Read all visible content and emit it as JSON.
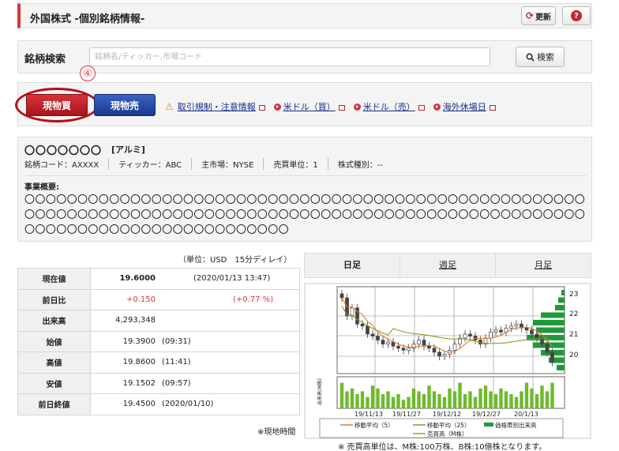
{
  "header": {
    "title": "外国株式 -個別銘柄情報-",
    "refresh_label": "更新",
    "help_label": "?"
  },
  "search": {
    "label": "銘柄検索",
    "placeholder": "銘柄名/ティッカー,市場コード",
    "button_label": "検索"
  },
  "annotation_marker": "④",
  "trade": {
    "buy_label": "現物買",
    "sell_label": "現物売",
    "links": [
      "取引規制・注意情報",
      "米ドル（買）",
      "米ドル（売）",
      "海外休場日"
    ]
  },
  "stock": {
    "name": "〇〇〇〇〇〇〇",
    "tag": "[アルミ]",
    "code": "銘柄コード：AXXXX",
    "ticker": "ティッカー：ABC",
    "market": "主市場：NYSE",
    "unit": "売買単位：1",
    "type": "株式種別：--",
    "business_label": "事業概要:",
    "business_text": "〇〇〇〇〇〇〇〇〇〇〇〇〇〇〇〇〇〇〇〇〇〇〇〇〇〇〇〇〇〇〇〇〇〇〇〇〇〇〇〇〇〇〇〇〇〇〇〇〇〇〇〇〇〇〇〇〇〇〇〇〇〇〇〇〇〇〇〇〇〇〇〇〇〇〇〇〇〇〇〇〇〇〇〇〇〇〇〇〇〇〇〇〇〇〇〇〇〇〇〇〇〇〇〇〇〇〇〇〇〇〇〇〇〇〇〇〇〇〇〇〇〇〇〇〇〇〇〇〇〇〇"
  },
  "quote": {
    "unit_note": "（単位：USD　15分ディレイ）",
    "rows": [
      {
        "label": "現在値",
        "value": "19.6000",
        "extra": "(2020/01/13 13:47)"
      },
      {
        "label": "前日比",
        "value": "+0.150",
        "extra": "(+0.77 %)"
      },
      {
        "label": "出来高",
        "value": "4,293,348",
        "extra": ""
      },
      {
        "label": "始値",
        "value": "19.3900",
        "extra": "(09:31)"
      },
      {
        "label": "高値",
        "value": "19.8600",
        "extra": "(11:41)"
      },
      {
        "label": "安値",
        "value": "19.1502",
        "extra": "(09:57)"
      },
      {
        "label": "前日終値",
        "value": "19.4500",
        "extra": "(2020/01/10)"
      }
    ],
    "footnote": "※現地時間"
  },
  "chart_tabs": [
    "日足",
    "週足",
    "月足"
  ],
  "chart_data": {
    "type": "line",
    "price_ticks": [
      "23",
      "22",
      "21",
      "20"
    ],
    "x": [
      "19/11/13",
      "19/11/27",
      "19/12/12",
      "19/12/27",
      "20/1/13"
    ],
    "legend": [
      "移動平均（5）",
      "移動平均（25）",
      "価格帯別出来高",
      "売買高（M株）"
    ],
    "volume_axis_label": "出来高(M株)",
    "colors": {
      "ma5": "#e07a2e",
      "ma25": "#8a9a2a",
      "volume": "#6dbb2c",
      "price_band": "#1f9a3a",
      "candle": "#444444"
    }
  },
  "chart_note": "※ 売買高単位は、M株:100万株、B株:10億株となります。"
}
